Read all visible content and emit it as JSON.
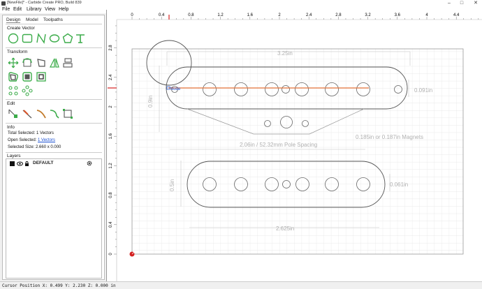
{
  "window": {
    "title": "[NewFile]* - Carbide Create PRO, Build 839"
  },
  "menu": [
    "File",
    "Edit",
    "Library",
    "View",
    "Help"
  ],
  "tabs": [
    "Design",
    "Model",
    "Toolpaths"
  ],
  "sections": {
    "create_vector": "Create Vector",
    "transform": "Transform",
    "edit": "Edit",
    "info": "Info",
    "layers": "Layers"
  },
  "info": {
    "total_selected_label": "Total Selected:",
    "total_selected_value": "1 Vectors",
    "open_selected_label": "Open Selected:",
    "open_selected_value": "1 Vectors",
    "selected_size_label": "Selected Size:",
    "selected_size_value": "2.660 x 0.000"
  },
  "layers": [
    {
      "name": "DEFAULT"
    }
  ],
  "ruler": {
    "x_ticks": [
      "0",
      "0.4",
      "0.8",
      "1.2",
      "1.6",
      "2",
      "2.4",
      "2.8",
      "3.2",
      "3.6",
      "4",
      "4.4"
    ],
    "y_ticks": [
      "2.8",
      "2.4",
      "2",
      "1.6",
      "1.2",
      "0.8",
      "0.4",
      "0"
    ]
  },
  "annotations": {
    "width_top": "3.25in",
    "right_top": "0.091in",
    "left_top": "0.9in",
    "pole_spacing": "2.06in / 52.32mm Pole Spacing",
    "magnets": "0.185in or 0.187in Magnets",
    "right_bottom": "0.061in",
    "left_bottom": "0.5in",
    "width_bottom": "2.625in",
    "node_label": "Node"
  },
  "status": {
    "cursor": "Cursor Position X: 0.499 Y: 2.230 Z: 0.000 in"
  },
  "colors": {
    "accent": "#3cac4a",
    "selection": "#e8743b",
    "origin": "#d42020"
  },
  "icons": {
    "create": [
      "circle-icon",
      "rectangle-icon",
      "polyline-icon",
      "ellipse-icon",
      "polygon-icon",
      "text-icon"
    ],
    "transform_row1": [
      "move-icon",
      "rotate-icon",
      "mirror-icon",
      "scale-icon",
      "align-icon"
    ],
    "transform_row2": [
      "offset-icon",
      "join-icon",
      "boolean-icon"
    ],
    "transform_row3": [
      "circular-array-icon",
      "grid-array-icon"
    ],
    "edit": [
      "node-edit-icon",
      "trim-icon",
      "fillet-icon",
      "smooth-icon",
      "bounding-box-icon"
    ]
  }
}
